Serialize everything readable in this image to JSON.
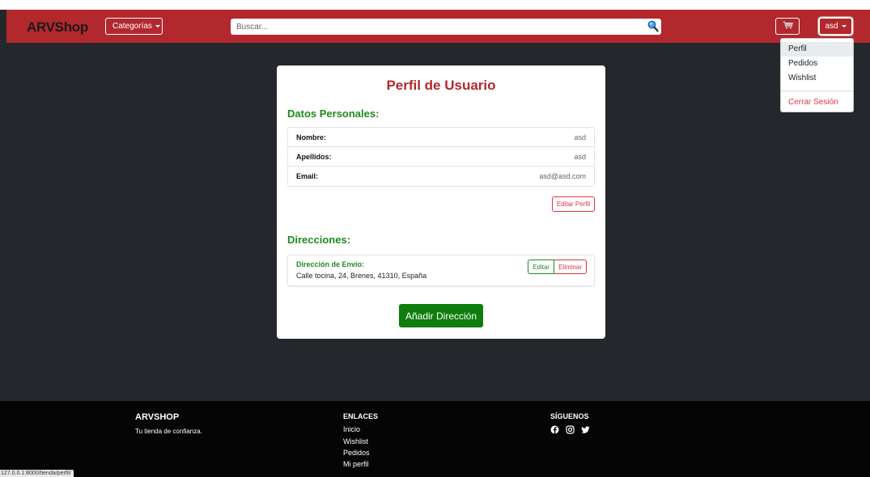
{
  "navbar": {
    "brand": "ARVShop",
    "categories_label": "Categorías",
    "search_placeholder": "Buscar...",
    "user_label": "asd"
  },
  "user_menu": {
    "items": [
      "Perfil",
      "Pedidos",
      "Wishlist"
    ],
    "logout": "Cerrar Sesión",
    "active": "Perfil"
  },
  "profile": {
    "title": "Perfil de Usuario",
    "personal_heading": "Datos Personales:",
    "fields": [
      {
        "label": "Nombre:",
        "value": "asd"
      },
      {
        "label": "Apellidos:",
        "value": "asd"
      },
      {
        "label": "Email:",
        "value": "asd@asd.com"
      }
    ],
    "edit_profile_label": "Editar Perfil",
    "addresses_heading": "Direcciones:",
    "address": {
      "type_label": "Dirección de Envío:",
      "text": "Calle tocina, 24, Brenes, 41310, España",
      "edit_label": "Editar",
      "delete_label": "Eliminar"
    },
    "add_address_label": "Añadir Dirección"
  },
  "footer": {
    "brand": "ARVSHOP",
    "tagline": "Tu tienda de confianza.",
    "links_heading": "ENLACES",
    "links": [
      "Inicio",
      "Wishlist",
      "Pedidos",
      "Mi perfil"
    ],
    "social_heading": "SÍGUENOS",
    "social_icons": [
      "facebook-icon",
      "instagram-icon",
      "twitter-icon"
    ]
  },
  "status_url": "127.0.0.1:8000/tienda/perfil/",
  "colors": {
    "brand_red": "#b3282d",
    "accent_green": "#1f8a1f",
    "button_green": "#0e7d0e",
    "danger": "#dc3545",
    "page_bg": "#24272b",
    "footer_bg": "#050505"
  }
}
